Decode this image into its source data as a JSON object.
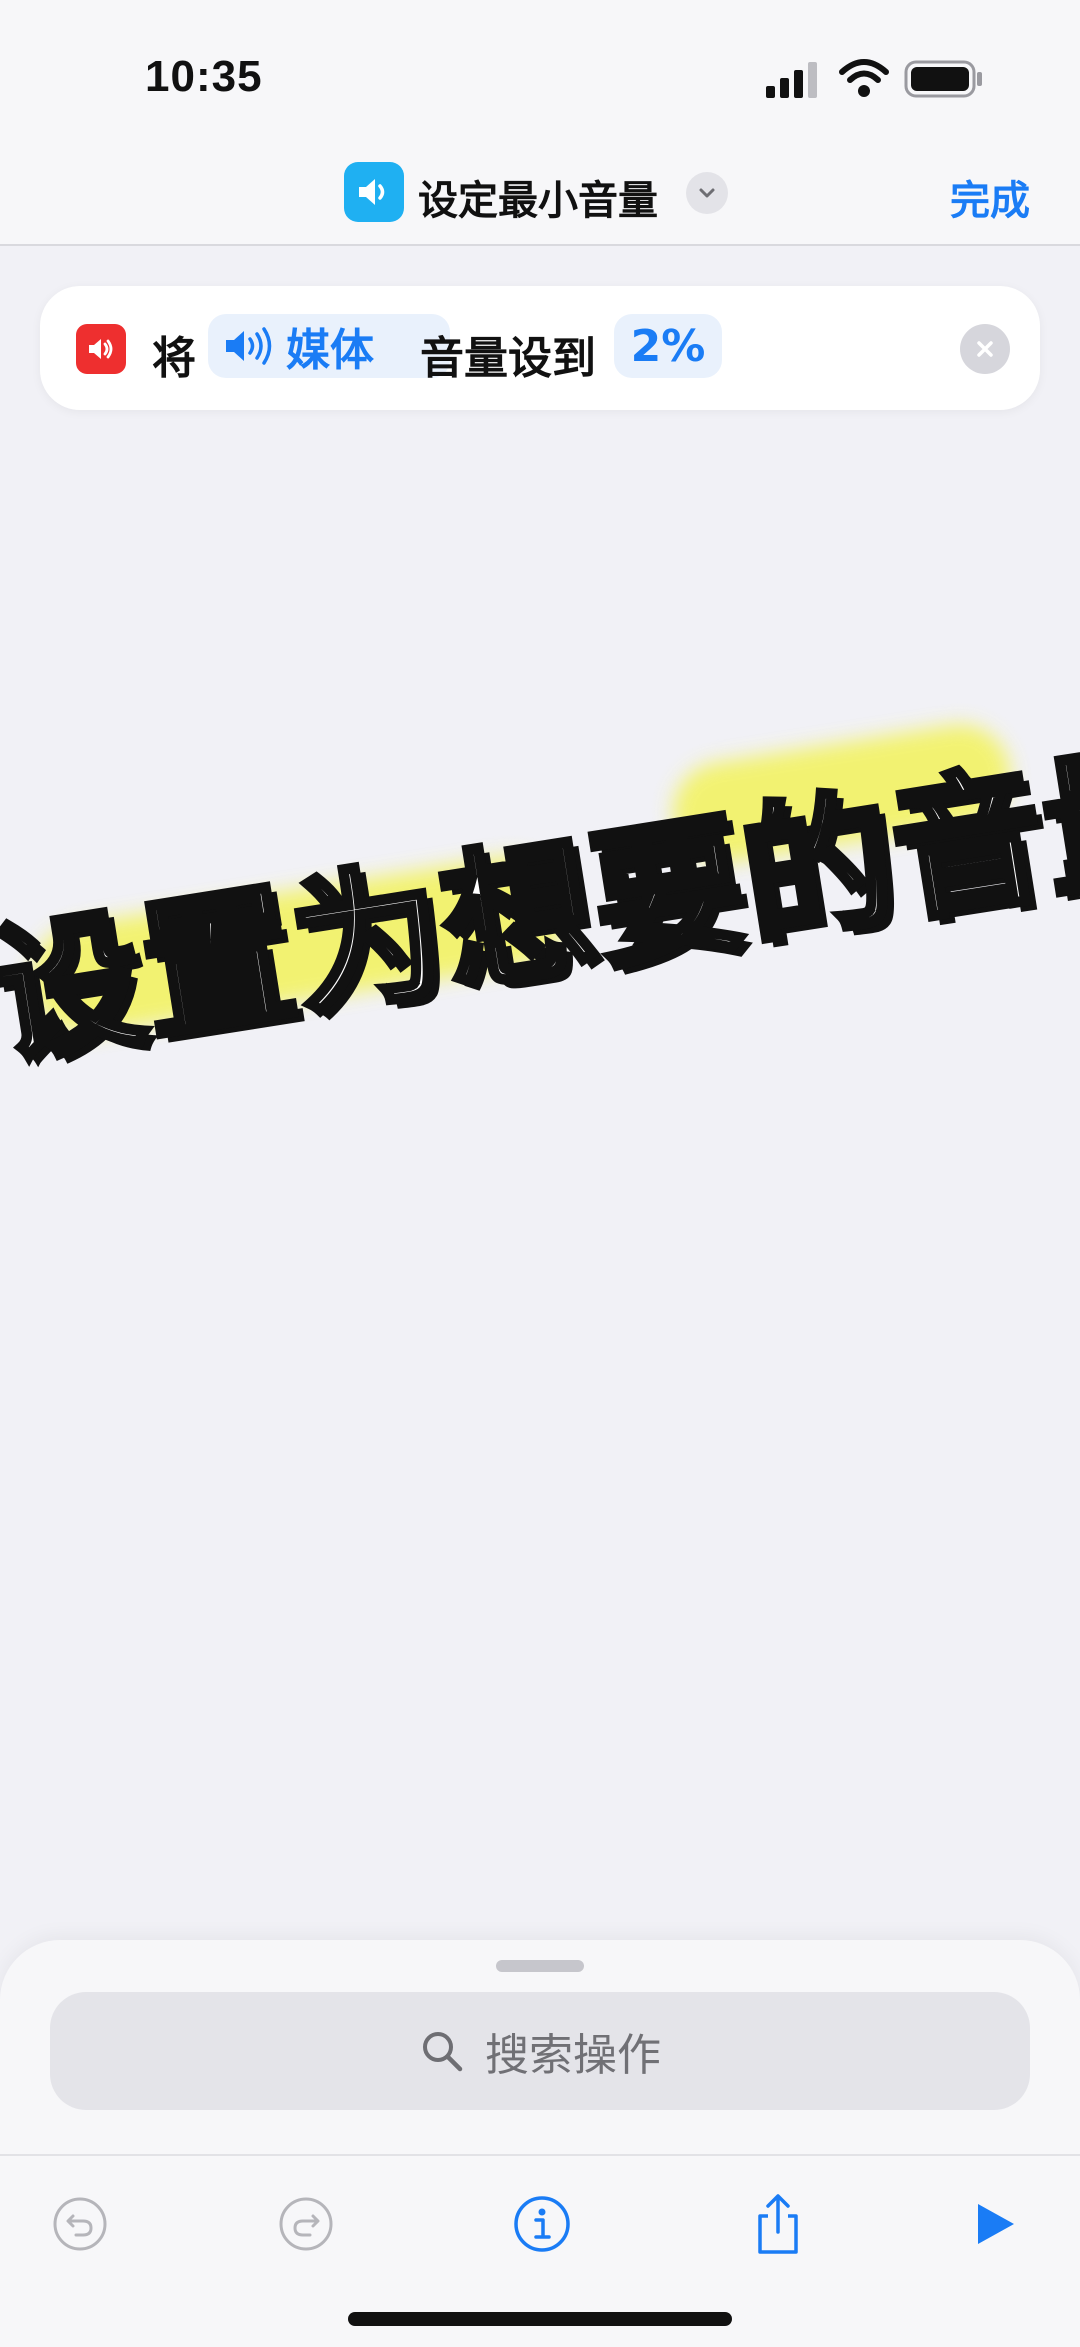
{
  "status": {
    "time": "10:35"
  },
  "nav": {
    "title": "设定最小音量",
    "done_label": "完成"
  },
  "action": {
    "prefix": "将",
    "target_label": "媒体",
    "middle": "音量设到",
    "value": "2%"
  },
  "overlay": {
    "caption": "设置为想要的音量"
  },
  "search": {
    "placeholder": "搜索操作"
  },
  "colors": {
    "accent": "#1a7cf5",
    "shortcut_icon": "#1fb0f2",
    "action_icon": "#ee2f2f",
    "highlight": "#f3f35a"
  },
  "icons": {
    "nav": "speaker-icon",
    "action": "speaker-icon",
    "clear": "close-icon",
    "undo": "undo-icon",
    "redo": "redo-icon",
    "info": "info-icon",
    "share": "share-icon",
    "run": "play-icon"
  }
}
